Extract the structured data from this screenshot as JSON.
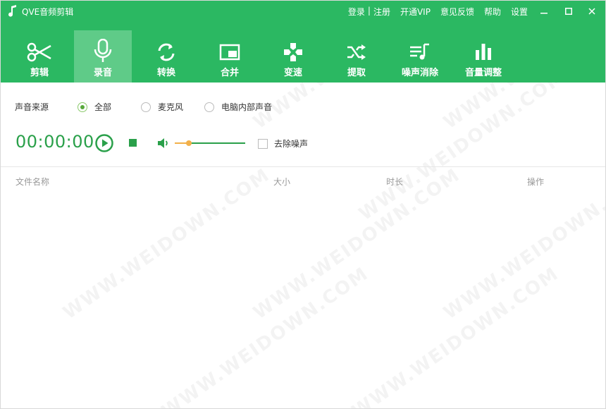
{
  "app": {
    "title": "QVE音频剪辑",
    "links": {
      "login": "登录",
      "separator": "|",
      "register": "注册",
      "vip": "开通VIP",
      "feedback": "意见反馈",
      "help": "帮助",
      "settings": "设置"
    }
  },
  "toolbar": {
    "tools": [
      {
        "label": "剪辑",
        "icon": "scissors-icon"
      },
      {
        "label": "录音",
        "icon": "microphone-icon",
        "active": true
      },
      {
        "label": "转换",
        "icon": "refresh-icon"
      },
      {
        "label": "合并",
        "icon": "picture-in-picture-icon"
      },
      {
        "label": "变速",
        "icon": "gamepad-icon"
      },
      {
        "label": "提取",
        "icon": "shuffle-icon"
      },
      {
        "label": "噪声消除",
        "icon": "playlist-music-icon"
      },
      {
        "label": "音量调整",
        "icon": "bar-chart-icon"
      }
    ]
  },
  "record": {
    "source_label": "声音来源",
    "sources": [
      "全部",
      "麦克风",
      "电脑内部声音"
    ],
    "selected_source": "全部",
    "time": "00:00:00",
    "volume_level": 0.2,
    "denoise_label": "去除噪声",
    "denoise_checked": false
  },
  "table": {
    "headers": [
      "文件名称",
      "大小",
      "时长",
      "操作"
    ]
  },
  "watermark": "WWW.WEIDOWN.COM",
  "colors": {
    "primary_green": "#2bb862",
    "active_tab": "#5fcb88",
    "accent_green": "#2aa04a",
    "slider_orange": "#f2b04a"
  }
}
